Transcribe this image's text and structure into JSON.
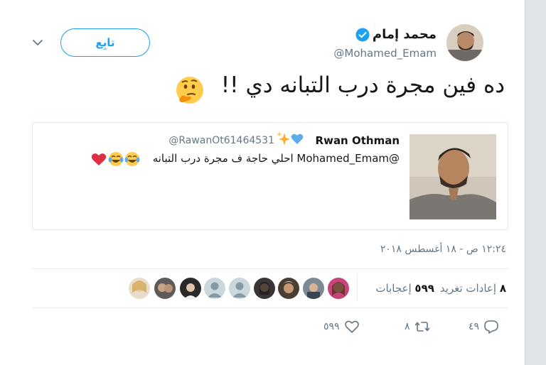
{
  "author": {
    "name": "محمد إمام",
    "handle": "@Mohamed_Emam",
    "verified_icon": "verified-badge-icon",
    "avatar_icon": "avatar-photo"
  },
  "follow_button": {
    "label": "تابِع"
  },
  "menu_icon": "chevron-down-icon",
  "tweet": {
    "text": "ده فين مجرة درب التبانه دي !!",
    "emoji": "thinking-face"
  },
  "quoted": {
    "name": "Rwan Othman",
    "name_emojis": [
      "blue-heart",
      "sparkles"
    ],
    "handle": "@RawanOt61464531",
    "text": "@Mohamed_Emam احلي حاجة ف مجرة درب التبانه",
    "text_emojis": [
      "face-with-tears-of-joy",
      "face-with-tears-of-joy",
      "red-heart"
    ]
  },
  "timestamp": "١٢:٢٤ ص - ١٨ أغسطس ٢٠١٨",
  "stats": {
    "retweets_count": "٨",
    "retweets_label": "إعادات تغريد",
    "likes_count": "٥٩٩",
    "likes_label": "إعجابات"
  },
  "likers": [
    "liker-1",
    "liker-2",
    "liker-3",
    "liker-4",
    "liker-5",
    "liker-6",
    "liker-7",
    "liker-8",
    "liker-9"
  ],
  "actions": {
    "reply_count": "٤٩",
    "retweet_count": "٨",
    "like_count": "٥٩٩"
  },
  "colors": {
    "accent": "#1da1f2",
    "muted": "#657786",
    "text": "#14171a",
    "border": "#e1e8ed"
  }
}
